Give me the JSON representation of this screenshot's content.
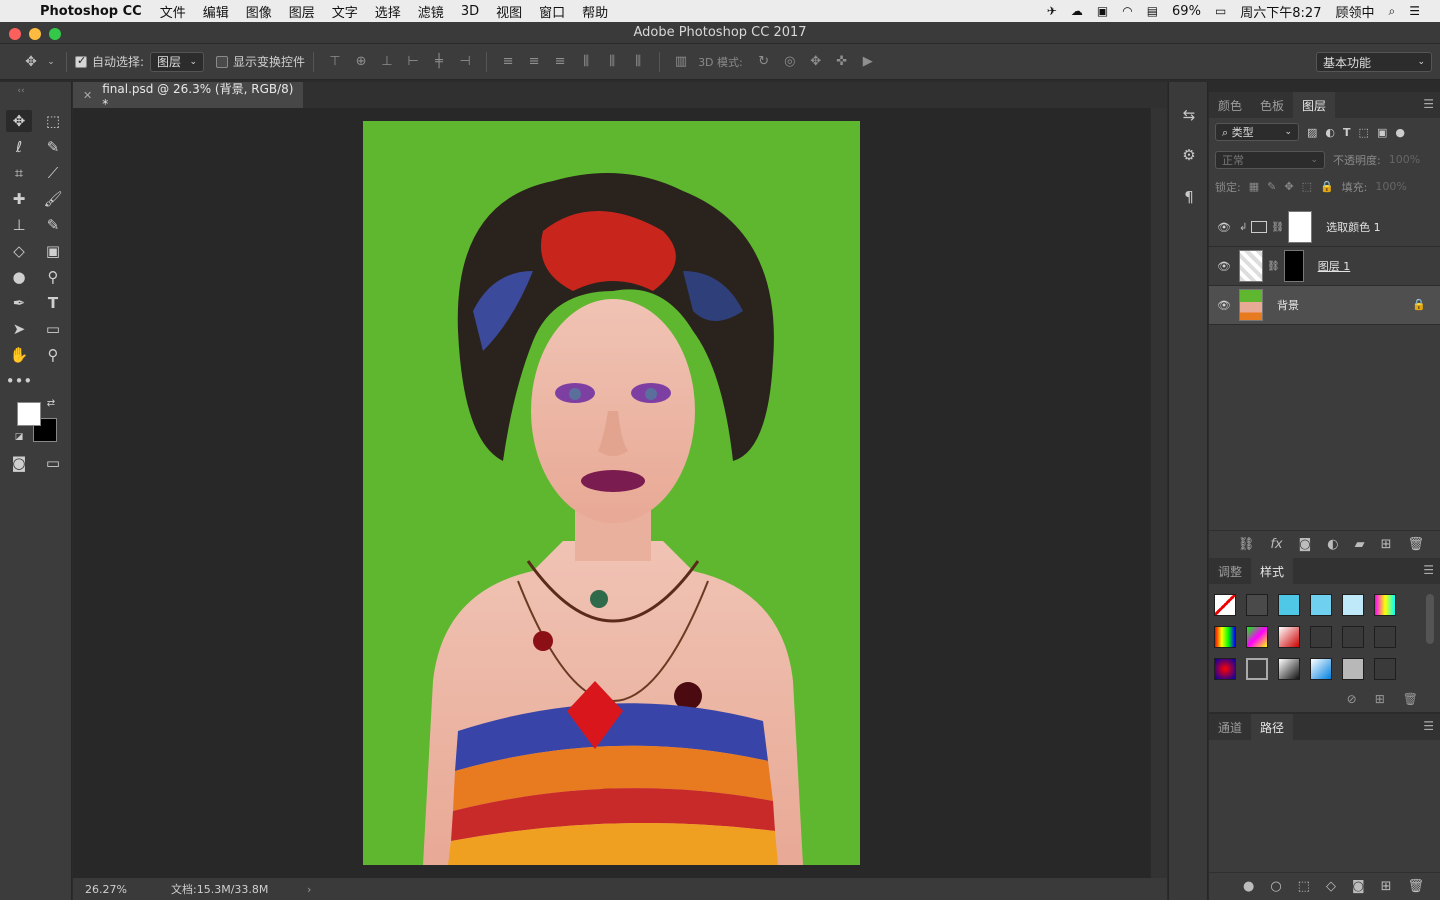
{
  "menubar": {
    "apple_icon": "apple-logo-icon",
    "app_name": "Photoshop CC",
    "items": [
      "文件",
      "编辑",
      "图像",
      "图层",
      "文字",
      "选择",
      "滤镜",
      "3D",
      "视图",
      "窗口",
      "帮助"
    ],
    "battery": "69%",
    "clock": "周六下午8:27",
    "user": "顾领中"
  },
  "window": {
    "title": "Adobe Photoshop CC 2017"
  },
  "options": {
    "auto_select_label": "自动选择:",
    "auto_select_target": "图层",
    "show_transform_label": "显示变换控件",
    "mode_3d_label": "3D 模式:",
    "workspace": "基本功能"
  },
  "document": {
    "tab_title": "final.psd @ 26.3% (背景, RGB/8) *",
    "zoom": "26.27%",
    "doc_size": "文档:15.3M/33.8M"
  },
  "layers_panel": {
    "tabs": [
      "颜色",
      "色板",
      "图层"
    ],
    "filter_kind": "类型",
    "blend_mode": "正常",
    "opacity_label": "不透明度:",
    "opacity_value": "100%",
    "lock_label": "锁定:",
    "fill_label": "填充:",
    "fill_value": "100%",
    "layers": [
      {
        "name": "选取颜色 1"
      },
      {
        "name": "图层 1"
      },
      {
        "name": "背景"
      }
    ]
  },
  "adjust_panel": {
    "tabs": [
      "调整",
      "样式"
    ]
  },
  "channels_panel": {
    "tabs": [
      "通道",
      "路径"
    ]
  },
  "colors": {
    "canvas_green": "#5fb72f",
    "fg": "#ffffff",
    "bg": "#000000"
  }
}
